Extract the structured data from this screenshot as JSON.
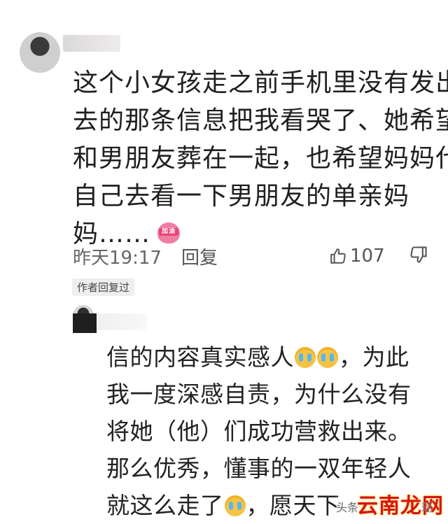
{
  "comment": {
    "lines": [
      "这个小女孩走之前手机里没有发出",
      "去的那条信息把我看哭了、她希望",
      "和男朋友葬在一起，也希望妈妈代",
      "自己去看一下男朋友的单亲妈",
      "妈……"
    ],
    "emoji_label": "加油",
    "time": "昨天19:17",
    "reply_label": "回复",
    "like_count": "107",
    "author_tag": "作者回复过"
  },
  "reply": {
    "line1_text": "信的内容真实感人",
    "line1_after": "，为此",
    "line2": "我一度深感自责，为什么没有",
    "line3": "将她（他）们成功营救出来。",
    "line4": "那么优秀，懂事的一双年轻人",
    "line5_before": "就这么走了",
    "line5_after": "，愿天下"
  },
  "watermark": {
    "small_left": "头条",
    "logo": "云南龙网",
    "small_right": "瑶"
  }
}
